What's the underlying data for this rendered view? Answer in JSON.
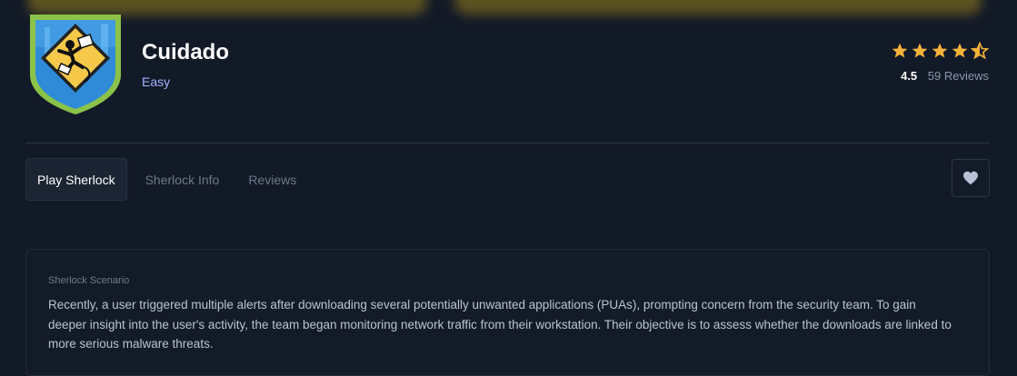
{
  "header": {
    "title": "Cuidado",
    "difficulty": "Easy",
    "badge_icon": "caution-sign-badge-icon"
  },
  "rating": {
    "stars": 4.5,
    "value": "4.5",
    "reviews": "59 Reviews",
    "star_color": "#f4b23a"
  },
  "tabs": [
    {
      "label": "Play Sherlock",
      "active": true
    },
    {
      "label": "Sherlock Info",
      "active": false
    },
    {
      "label": "Reviews",
      "active": false
    }
  ],
  "favorite": {
    "icon": "heart-icon"
  },
  "scenario": {
    "label": "Sherlock Scenario",
    "text": "Recently, a user triggered multiple alerts after downloading several potentially unwanted applications (PUAs), prompting concern from the security team. To gain deeper insight into the user's activity, the team began monitoring network traffic from their workstation. Their objective is to assess whether the downloads are linked to more serious malware threats."
  },
  "colors": {
    "background": "#131a27",
    "accent": "#9fb3ff",
    "badge_green": "#8bc34a"
  }
}
